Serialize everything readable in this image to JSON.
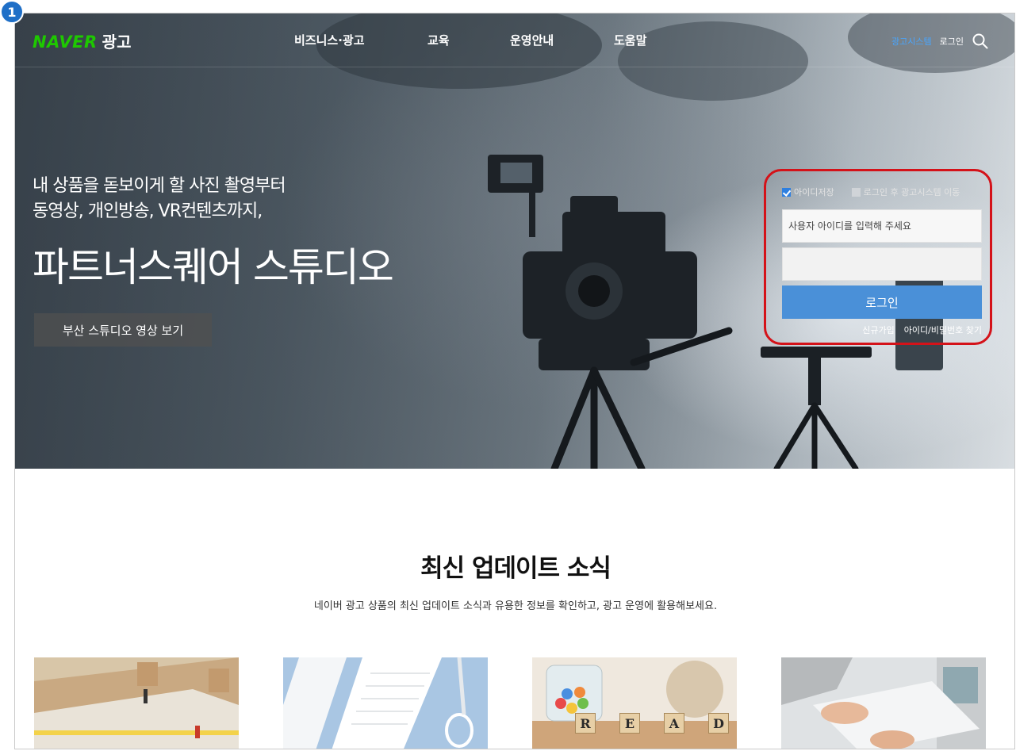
{
  "step_badge": "1",
  "header": {
    "logo_brand": "NAVER",
    "logo_suffix": "광고",
    "nav": [
      "비즈니스·광고",
      "교육",
      "운영안내",
      "도움말"
    ],
    "util_system": "광고시스템",
    "util_login": "로그인",
    "search_icon": "search-icon"
  },
  "hero": {
    "sub_line1": "내 상품을 돋보이게 할 사진 촬영부터",
    "sub_line2": "동영상, 개인방송, VR컨텐츠까지,",
    "title": "파트너스퀘어 스튜디오",
    "button": "부산 스튜디오 영상 보기"
  },
  "login": {
    "save_id_label": "아이디저장",
    "save_id_checked": true,
    "goto_system_label": "로그인 후 광고시스템 이동",
    "goto_system_checked": false,
    "id_placeholder": "사용자 아이디를 입력해 주세요",
    "password_value": "",
    "button": "로그인",
    "link_signup": "신규가입",
    "link_find": "아이디/비밀번호 찾기",
    "highlight_color": "#d41219",
    "button_color": "#4a90d8"
  },
  "updates": {
    "title": "최신 업데이트 소식",
    "description": "네이버 광고 상품의 최신 업데이트 소식과 유용한 정보를 확인하고, 광고 운영에 활용해보세요.",
    "cards": [
      {
        "image": "miniature-figures-on-book"
      },
      {
        "image": "ruler-and-scissors"
      },
      {
        "image": "candy-jar-read-blocks",
        "block_letters": [
          "R",
          "E",
          "A",
          "D"
        ]
      },
      {
        "image": "hands-on-laptop"
      }
    ]
  },
  "colors": {
    "brand_green": "#1ec800",
    "system_blue": "#48a6ff"
  }
}
